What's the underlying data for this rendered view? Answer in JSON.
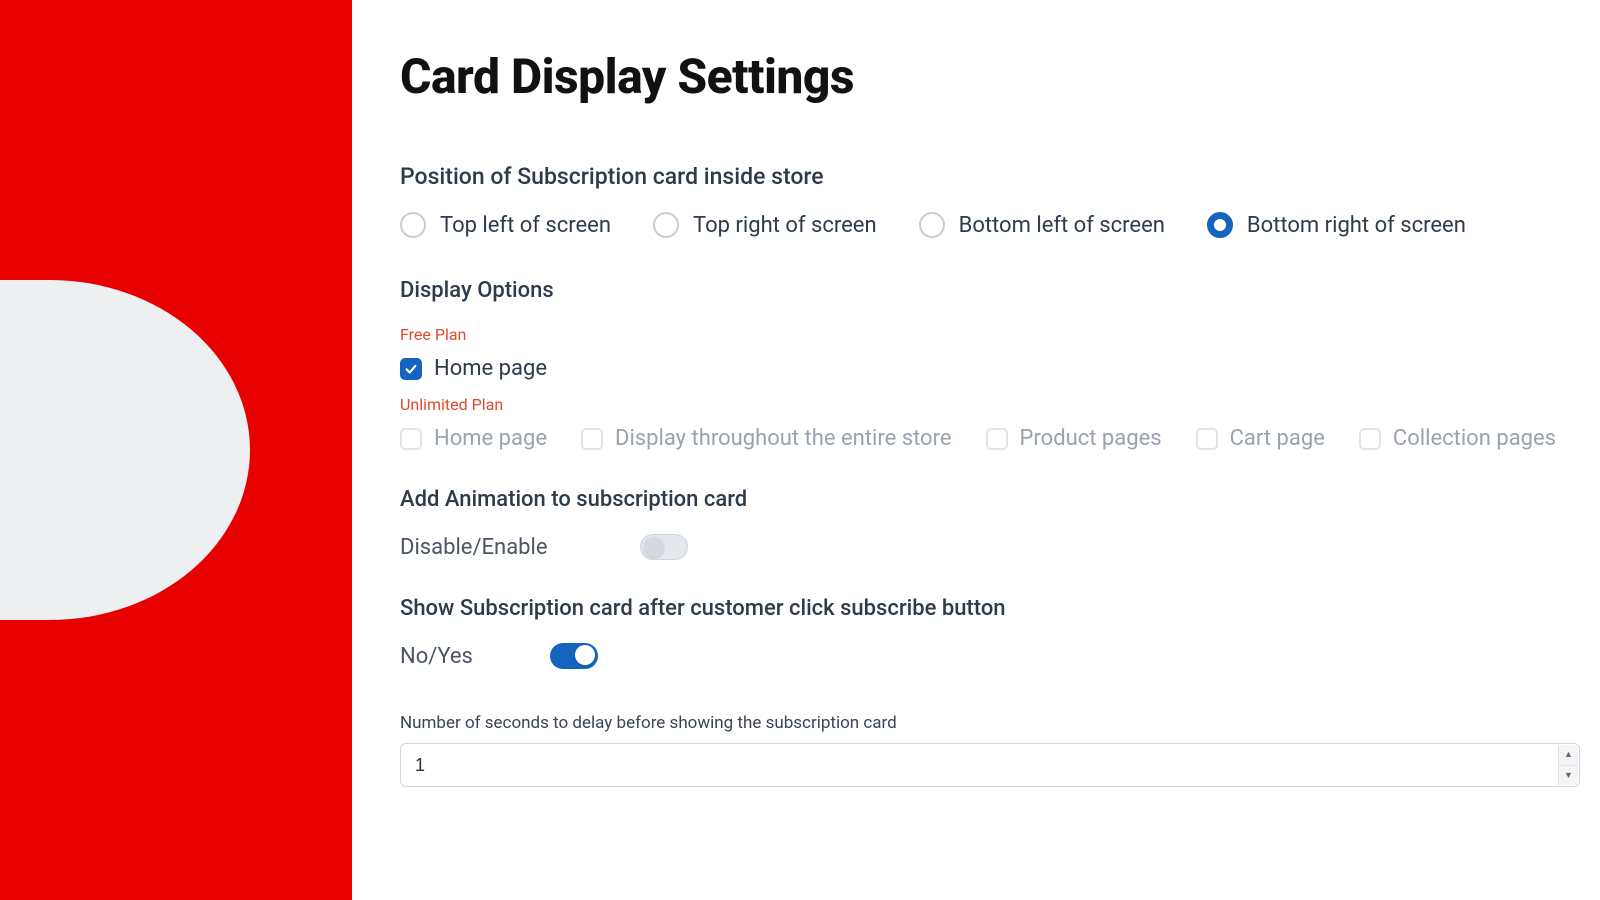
{
  "page_title": "Card Display Settings",
  "position_section": {
    "heading": "Position of Subscription card inside store",
    "options": [
      {
        "label": "Top left of screen",
        "selected": false
      },
      {
        "label": "Top right of screen",
        "selected": false
      },
      {
        "label": "Bottom left of screen",
        "selected": false
      },
      {
        "label": "Bottom right of screen",
        "selected": true
      }
    ]
  },
  "display_options": {
    "heading": "Display Options",
    "free_plan_label": "Free Plan",
    "free_plan_items": [
      {
        "label": "Home page",
        "checked": true
      }
    ],
    "unlimited_plan_label": "Unlimited Plan",
    "unlimited_plan_items": [
      {
        "label": "Home page",
        "checked": false
      },
      {
        "label": "Display throughout the entire store",
        "checked": false
      },
      {
        "label": "Product pages",
        "checked": false
      },
      {
        "label": "Cart page",
        "checked": false
      },
      {
        "label": "Collection pages",
        "checked": false
      }
    ]
  },
  "animation": {
    "heading": "Add Animation to subscription card",
    "label": "Disable/Enable",
    "enabled": false
  },
  "show_after_subscribe": {
    "heading": "Show Subscription card after customer click subscribe button",
    "label": "No/Yes",
    "enabled": true
  },
  "delay": {
    "label": "Number of seconds to delay before showing the subscription card",
    "value": "1"
  }
}
